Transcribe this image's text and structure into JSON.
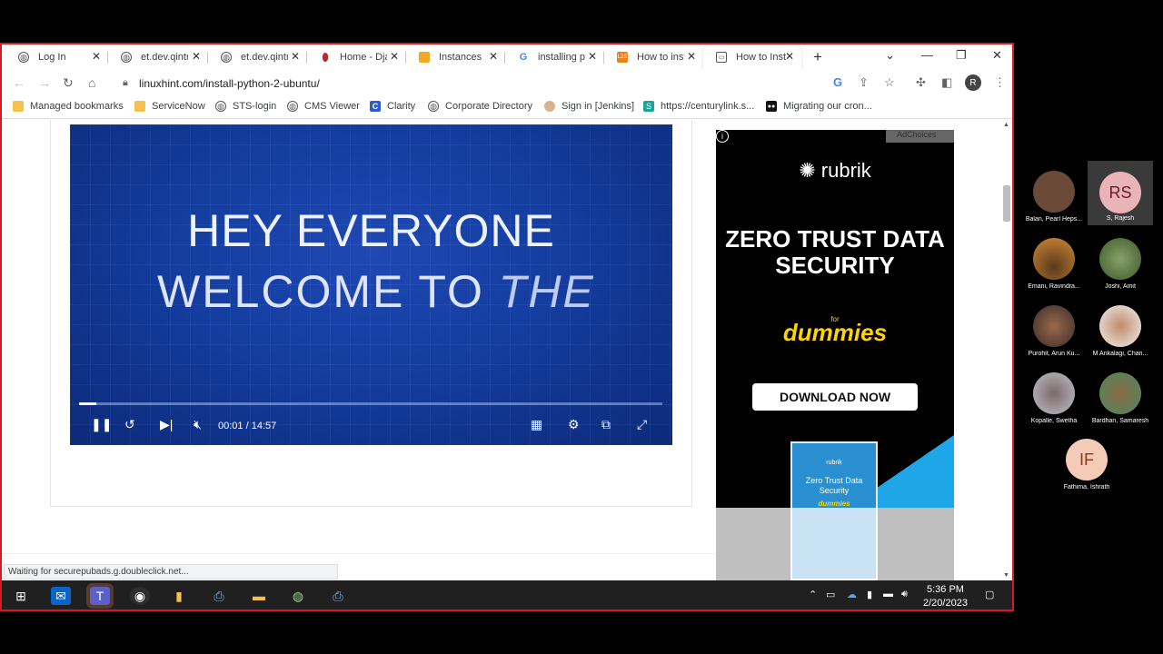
{
  "browser": {
    "tabs": [
      {
        "label": "Log In",
        "icon": "globe-icon"
      },
      {
        "label": "et.dev.qintr",
        "icon": "globe-icon"
      },
      {
        "label": "et.dev.qintr",
        "icon": "globe-icon"
      },
      {
        "label": "Home - Dja",
        "icon": "django-icon"
      },
      {
        "label": "Instances |",
        "icon": "aws-icon"
      },
      {
        "label": "installing p",
        "icon": "google-icon"
      },
      {
        "label": "How to inst",
        "icon": "l2s-icon"
      },
      {
        "label": "How to Inst",
        "icon": "linuxhint-icon"
      }
    ],
    "active_tab_index": 7,
    "url": "linuxhint.com/install-python-2-ubuntu/",
    "profile_initial": "R",
    "bookmarks": [
      {
        "label": "Managed bookmarks",
        "icon": "folder-icon"
      },
      {
        "label": "ServiceNow",
        "icon": "folder-icon"
      },
      {
        "label": "STS-login",
        "icon": "globe-icon"
      },
      {
        "label": "CMS Viewer",
        "icon": "globe-icon"
      },
      {
        "label": "Clarity",
        "icon": "clarity-icon"
      },
      {
        "label": "Corporate Directory",
        "icon": "globe-icon"
      },
      {
        "label": "Sign in [Jenkins]",
        "icon": "jenkins-icon"
      },
      {
        "label": "https://centurylink.s...",
        "icon": "centurylink-icon"
      },
      {
        "label": "Migrating our cron...",
        "icon": "medium-icon"
      }
    ],
    "status_text": "Waiting for securepubads.g.doubleclick.net..."
  },
  "video": {
    "line1": "HEY EVERYONE",
    "line2": "WELCOME TO",
    "line2_italic": "THE",
    "current_time": "00:01",
    "separator": "/",
    "duration": "14:57",
    "progress_fraction": 0.002
  },
  "ad": {
    "choices_label": "AdChoices",
    "brand": "rubrik",
    "headline": "ZERO TRUST DATA SECURITY",
    "for_label": "for",
    "dummies": "dummies",
    "cta": "DOWNLOAD NOW",
    "book_brand": "rubrik",
    "book_title": "Zero Trust Data Security",
    "book_dummies": "dummies"
  },
  "taskbar": {
    "time": "5:36 PM",
    "date": "2/20/2023"
  },
  "participants": [
    {
      "name": "Balan, Pearl Heps...",
      "initials": "",
      "color": "#6b4a3a"
    },
    {
      "name": "S, Rajesh",
      "initials": "RS",
      "color": "#e8b4b8"
    },
    {
      "name": "Emani, Ravindra...",
      "initials": "",
      "color": "#c07a3a"
    },
    {
      "name": "Joshi, Amit",
      "initials": "",
      "color": "#4a6a3a"
    },
    {
      "name": "Purohit, Arun Ku...",
      "initials": "",
      "color": "#7a4a3a"
    },
    {
      "name": "M Ankalagi, Chan...",
      "initials": "",
      "color": "#b07a60"
    },
    {
      "name": "Kopalle, Swetha",
      "initials": "",
      "color": "#5a4a4a"
    },
    {
      "name": "Bardhan, Samaresh",
      "initials": "",
      "color": "#6a5a4a"
    },
    {
      "name": "Fathima, Ishrath",
      "initials": "IF",
      "color": "#f3cbb6"
    }
  ],
  "colors": {
    "share_border": "#d71921",
    "video_blue": "#143d9f",
    "taskbar": "#202020"
  }
}
